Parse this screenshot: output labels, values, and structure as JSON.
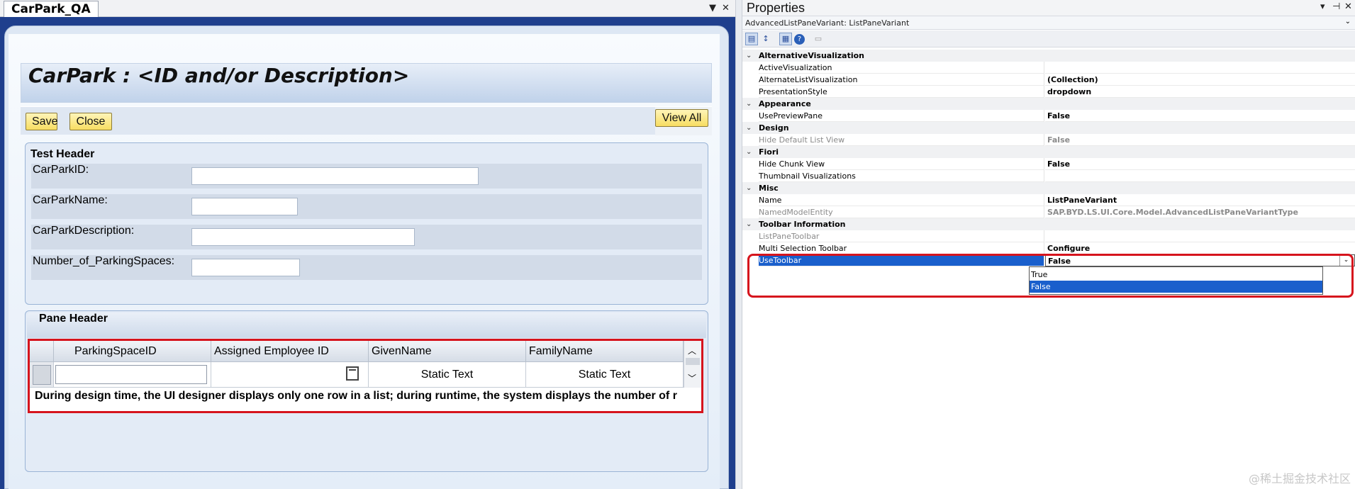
{
  "designer": {
    "tab_label": "CarPark_QA",
    "tab_menu_glyph": "▼",
    "tab_close_glyph": "✕",
    "page_title": "CarPark : <ID and/or Description>",
    "toolbar": {
      "save": "Save",
      "close": "Close",
      "view_all": "View All"
    },
    "header_section": {
      "title": "Test Header",
      "fields": [
        {
          "label": "CarParkID:"
        },
        {
          "label": "CarParkName:"
        },
        {
          "label": "CarParkDescription:"
        },
        {
          "label": "Number_of_ParkingSpaces:"
        }
      ]
    },
    "pane_section": {
      "title": "Pane Header",
      "columns": [
        "ParkingSpaceID",
        "Assigned Employee ID",
        "GivenName",
        "FamilyName"
      ],
      "row": {
        "given_name": "Static Text",
        "family_name": "Static Text"
      },
      "hint": "During design time, the UI designer displays only one row in a list; during runtime, the system displays the number of r"
    }
  },
  "properties": {
    "title": "Properties",
    "title_buttons": [
      "▾",
      "⊣",
      "✕"
    ],
    "object": "AdvancedListPaneVariant: ListPaneVariant",
    "tools": [
      "categorized-icon",
      "alphabetical-icon",
      "properties-icon",
      "help-icon",
      "property-pages-icon"
    ],
    "rows": [
      {
        "type": "category",
        "name": "AlternativeVisualization"
      },
      {
        "type": "prop",
        "name": "ActiveVisualization",
        "value": ""
      },
      {
        "type": "prop",
        "name": "AlternateListVisualization",
        "value": "(Collection)"
      },
      {
        "type": "prop",
        "name": "PresentationStyle",
        "value": "dropdown"
      },
      {
        "type": "category",
        "name": "Appearance"
      },
      {
        "type": "prop",
        "name": "UsePreviewPane",
        "value": "False"
      },
      {
        "type": "category",
        "name": "Design"
      },
      {
        "type": "prop",
        "name": "Hide Default List View",
        "value": "False",
        "readonly": true
      },
      {
        "type": "category",
        "name": "Fiori"
      },
      {
        "type": "prop",
        "name": "Hide Chunk View",
        "value": "False"
      },
      {
        "type": "prop",
        "name": "Thumbnail Visualizations",
        "value": ""
      },
      {
        "type": "category",
        "name": "Misc"
      },
      {
        "type": "prop",
        "name": "Name",
        "value": "ListPaneVariant"
      },
      {
        "type": "prop",
        "name": "NamedModelEntity",
        "value": "SAP.BYD.LS.UI.Core.Model.AdvancedListPaneVariantType",
        "readonly": true
      },
      {
        "type": "category",
        "name": "Toolbar Information"
      },
      {
        "type": "prop",
        "name": "ListPaneToolbar",
        "value": "",
        "readonly": true
      },
      {
        "type": "prop",
        "name": "Multi Selection Toolbar",
        "value": "Configure"
      },
      {
        "type": "prop",
        "name": "UseToolbar",
        "value": "False",
        "selected": true
      }
    ],
    "dropdown_options": [
      "True",
      "False"
    ],
    "dropdown_selected": "False"
  },
  "watermark": "@稀土掘金技术社区",
  "colors": {
    "highlight": "#d6141d",
    "selection": "#1a5fcc",
    "button": "#f7dd62",
    "frame": "#1f3f8d"
  }
}
